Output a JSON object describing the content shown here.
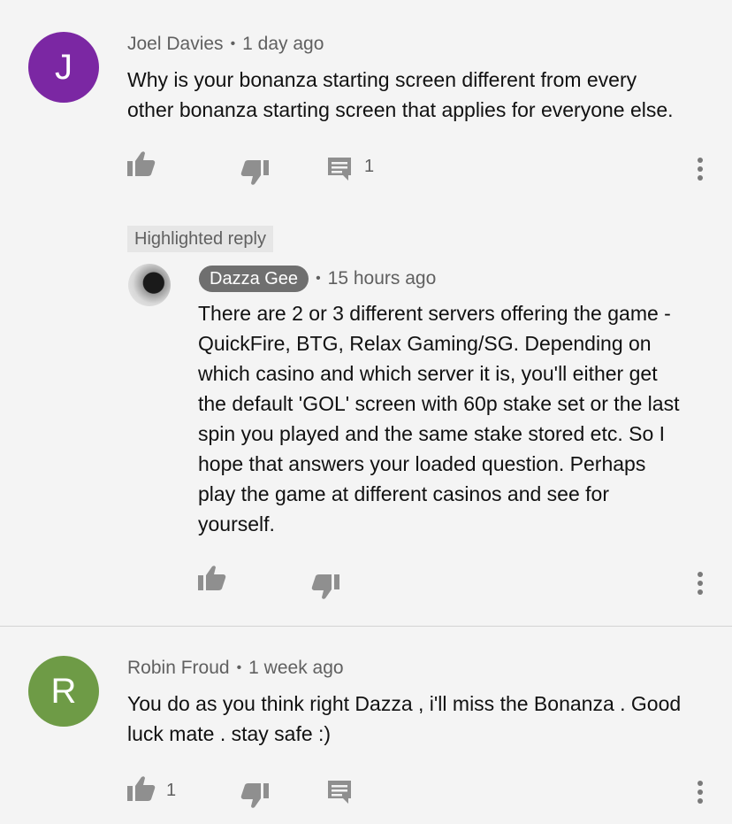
{
  "comments": [
    {
      "author": "Joel Davies",
      "avatar_letter": "J",
      "avatar_color": "#7b27a3",
      "time": "1 day ago",
      "text_lines": [
        "Why is your bonanza starting screen different from every",
        "other bonanza starting screen that applies for everyone else."
      ],
      "like_count": "",
      "reply_count": "1"
    },
    {
      "author": "Robin Froud",
      "avatar_letter": "R",
      "avatar_color": "#6e9b46",
      "time": "1 week ago",
      "text_lines": [
        "You do as you think right  Dazza , i'll miss the Bonanza . Good",
        "luck mate . stay safe :)"
      ],
      "like_count": "1",
      "reply_count": ""
    }
  ],
  "highlighted_reply": {
    "label": "Highlighted reply",
    "author": "Dazza Gee",
    "time": "15 hours ago",
    "text_lines": [
      "There are 2 or 3 different servers offering the game -",
      "QuickFire, BTG, Relax Gaming/SG.  Depending on",
      "which casino and which server it is, you'll either get",
      "the default 'GOL' screen with 60p stake set or the last",
      "spin you played and the same stake stored etc.  So I",
      "hope that answers your loaded question.  Perhaps",
      "play the game at different casinos and see for",
      "yourself."
    ]
  },
  "icons": {
    "like": "thumbs-up-icon",
    "dislike": "thumbs-down-icon",
    "reply": "comment-icon",
    "more": "more-vert-icon"
  }
}
